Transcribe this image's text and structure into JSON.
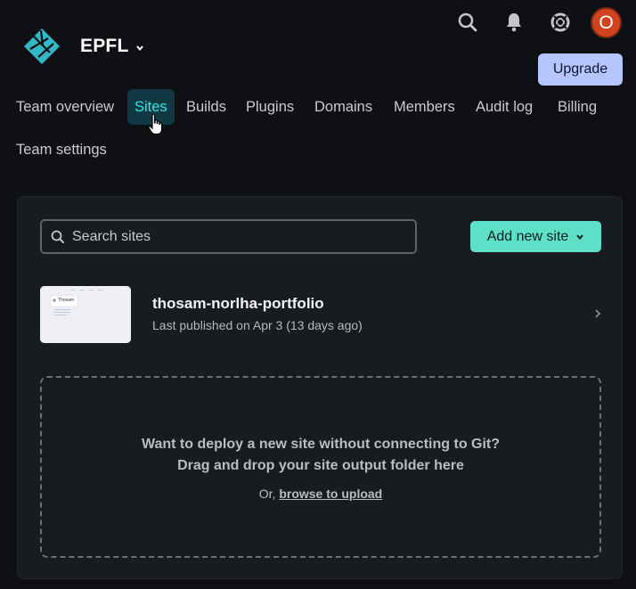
{
  "header": {
    "team_name": "EPFL",
    "avatar_initial": "O",
    "upgrade_label": "Upgrade"
  },
  "icons": {
    "logo": "netlify-logo",
    "search": "search-icon",
    "bell": "bell-icon",
    "help": "lifebuoy-icon",
    "team_dropdown": "chevron-down-icon"
  },
  "nav": {
    "items": [
      {
        "label": "Team overview",
        "active": false
      },
      {
        "label": "Sites",
        "active": true
      },
      {
        "label": "Builds",
        "active": false
      },
      {
        "label": "Plugins",
        "active": false
      },
      {
        "label": "Domains",
        "active": false
      },
      {
        "label": "Members",
        "active": false
      },
      {
        "label": "Audit log",
        "active": false
      },
      {
        "label": "Billing",
        "active": false
      },
      {
        "label": "Team settings",
        "active": false
      }
    ]
  },
  "sites": {
    "search_placeholder": "Search sites",
    "add_label": "Add new site",
    "list": [
      {
        "name": "thosam-norlha-portfolio",
        "meta": "Last published on Apr 3 (13 days ago)",
        "thumb_text": "Thosam"
      }
    ]
  },
  "dropzone": {
    "line1": "Want to deploy a new site without connecting to Git?",
    "line2": "Drag and drop your site output folder here",
    "line3_prefix": "Or, ",
    "link_label": "browse to upload"
  },
  "colors": {
    "background": "#0e1014",
    "card": "#181b20",
    "accent_teal": "#32e6e2",
    "add_button": "#5ee0c8",
    "upgrade_button": "#b5c6ff",
    "avatar": "#d2431f"
  }
}
